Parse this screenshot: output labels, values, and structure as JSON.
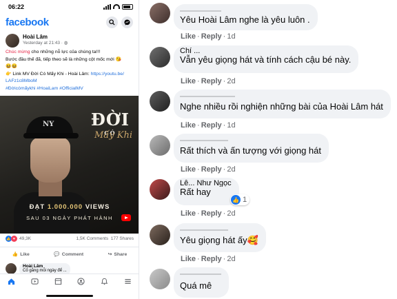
{
  "status_bar": {
    "time": "06:22"
  },
  "app": {
    "logo": "facebook"
  },
  "post": {
    "author": "Hoài Lâm",
    "time": "Yesterday at 21:43 · ",
    "line1_red": "Chúc mừng",
    "line1_rest": " cho những nỗ lực của chúng ta!!!",
    "line2": "Bước đầu thế đã, tiếp theo sẽ là những cột mốc mới 😘",
    "line3": "😆😆",
    "line4_prefix": "👉 Link MV Đời Có Mấy Khi - Hoài Lâm: ",
    "line4_link": "https://youtu.be/",
    "line5_link": "LAFz1c8MboM",
    "hashtags": "#Đờicómấykhi #HoaiLam #OfficialMV",
    "image": {
      "title_main": "ĐỜI",
      "title_small": "CÓ",
      "title_script": "Mấy Khi",
      "cap_logo": "NY",
      "views_prefix": "ĐẠT ",
      "views_number": "1.000.000",
      "views_suffix": " VIEWS",
      "release": "SAU 03 NGÀY PHÁT HÀNH"
    },
    "reactions_count": "49,3K",
    "comments_count": "1,5K Comments",
    "shares_count": "177 Shares",
    "actions": {
      "like": "Like",
      "comment": "Comment",
      "share": "Share"
    },
    "comment_peek": {
      "name": "Hoài Lâm",
      "text": "Cố gắng mỗi ngày để ..."
    }
  },
  "tabs": [
    "home",
    "video",
    "marketplace",
    "groups",
    "notifications",
    "menu"
  ],
  "icons": {
    "search": "search-icon",
    "messenger": "messenger-icon",
    "home": "home-icon",
    "video": "video-icon",
    "marketplace": "marketplace-icon",
    "groups": "groups-icon",
    "notifications": "bell-icon",
    "menu": "menu-icon"
  },
  "comments": [
    {
      "text": "Yêu Hoài Lâm nghe là yêu luôn .",
      "like": "Like",
      "reply": "Reply",
      "age": "1d"
    },
    {
      "name": "Chí ...",
      "text": "Vẫn yêu giọng hát và tính cách cậu bé này.",
      "like": "Like",
      "reply": "Reply",
      "age": "2d"
    },
    {
      "text": "Nghe nhiều rồi nghiện những bài của Hoài Lâm hát",
      "like": "Like",
      "reply": "Reply",
      "age": "1d"
    },
    {
      "text": "Rất thích và ấn tượng với giọng hát",
      "like": "Like",
      "reply": "Reply",
      "age": "2d"
    },
    {
      "name": "Lê... Như Ngọc",
      "text": "Rất hay",
      "like": "Like",
      "reply": "Reply",
      "age": "2d",
      "reaction_count": "1"
    },
    {
      "text": "Yêu giọng hát ấy🥰",
      "like": "Like",
      "reply": "Reply",
      "age": "2d"
    },
    {
      "text": "Quá mê",
      "like": "",
      "reply": "",
      "age": ""
    }
  ],
  "colors": {
    "accent": "#1877f2",
    "bubble": "#f0f2f5",
    "meta": "#65676b",
    "love": "#f33e58"
  }
}
